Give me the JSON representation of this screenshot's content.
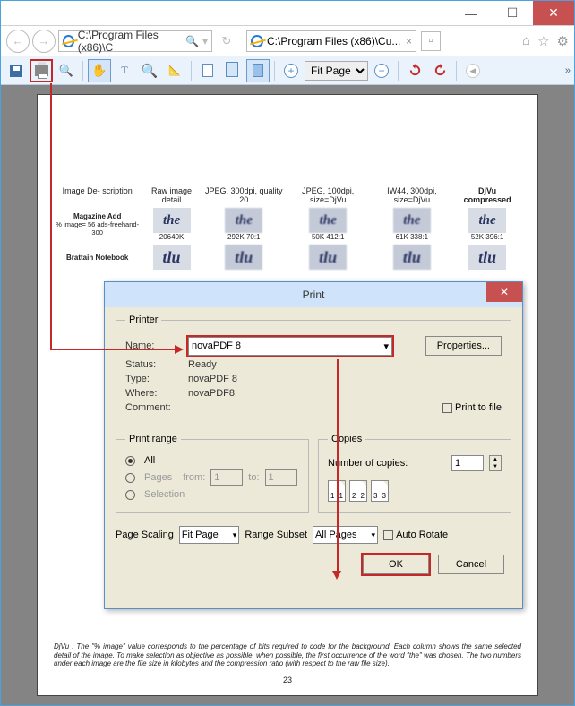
{
  "window": {
    "min": "—",
    "max": "☐",
    "close": "✕"
  },
  "navbar": {
    "back": "←",
    "fwd": "→",
    "address": "C:\\Program Files (x86)\\C",
    "search_icon": "🔍",
    "refresh": "↻",
    "tab_text": "C:\\Program Files (x86)\\Cu...",
    "tab_close": "×",
    "home": "⌂",
    "star": "☆",
    "gear": "⚙"
  },
  "toolbar": {
    "zoom_value": "Fit Page",
    "plus": "+",
    "minus": "−",
    "overflow": "»"
  },
  "doc": {
    "headers": [
      "Image De-\nscription",
      "Raw image\ndetail",
      "JPEG,\n300dpi,\nquality 20",
      "JPEG,\n100dpi,\nsize=DjVu",
      "IW44,\n300dpi,\nsize=DjVu",
      "DjVu\ncompressed"
    ],
    "row1_head": "Magazine\nAdd",
    "row1_sub": "% image= 56\nads-freehand-300",
    "row1_cells": [
      "20640K",
      "292K 70:1",
      "50K 412:1",
      "61K 338:1",
      "52K 396:1"
    ],
    "row2_head": "Brattain\nNotebook",
    "thumb_the": "the",
    "thumb_tlu": "tlu",
    "footnote": "DjVu . The \"% image\" value corresponds to the percentage of bits required to code for the background. Each column shows the same selected detail of the image. To make selection as objective as possible, when possible, the first occurrence of the word \"the\" was chosen. The two numbers under each image are the file size in kilobytes and the compression ratio (with respect to the raw file size).",
    "page_num": "23"
  },
  "print": {
    "title": "Print",
    "close": "✕",
    "printer_legend": "Printer",
    "name_label": "Name:",
    "name_value": "novaPDF 8",
    "properties": "Properties...",
    "status_label": "Status:",
    "status_value": "Ready",
    "type_label": "Type:",
    "type_value": "novaPDF 8",
    "where_label": "Where:",
    "where_value": "novaPDF8",
    "comment_label": "Comment:",
    "print_to_file": "Print to file",
    "range_legend": "Print range",
    "all": "All",
    "pages": "Pages",
    "from": "from:",
    "from_v": "1",
    "to": "to:",
    "to_v": "1",
    "selection": "Selection",
    "copies_legend": "Copies",
    "num_copies": "Number of copies:",
    "copies_v": "1",
    "scaling_label": "Page Scaling",
    "scaling_value": "Fit Page",
    "subset_label": "Range Subset",
    "subset_value": "All Pages",
    "auto_rotate": "Auto Rotate",
    "ok": "OK",
    "cancel": "Cancel"
  }
}
